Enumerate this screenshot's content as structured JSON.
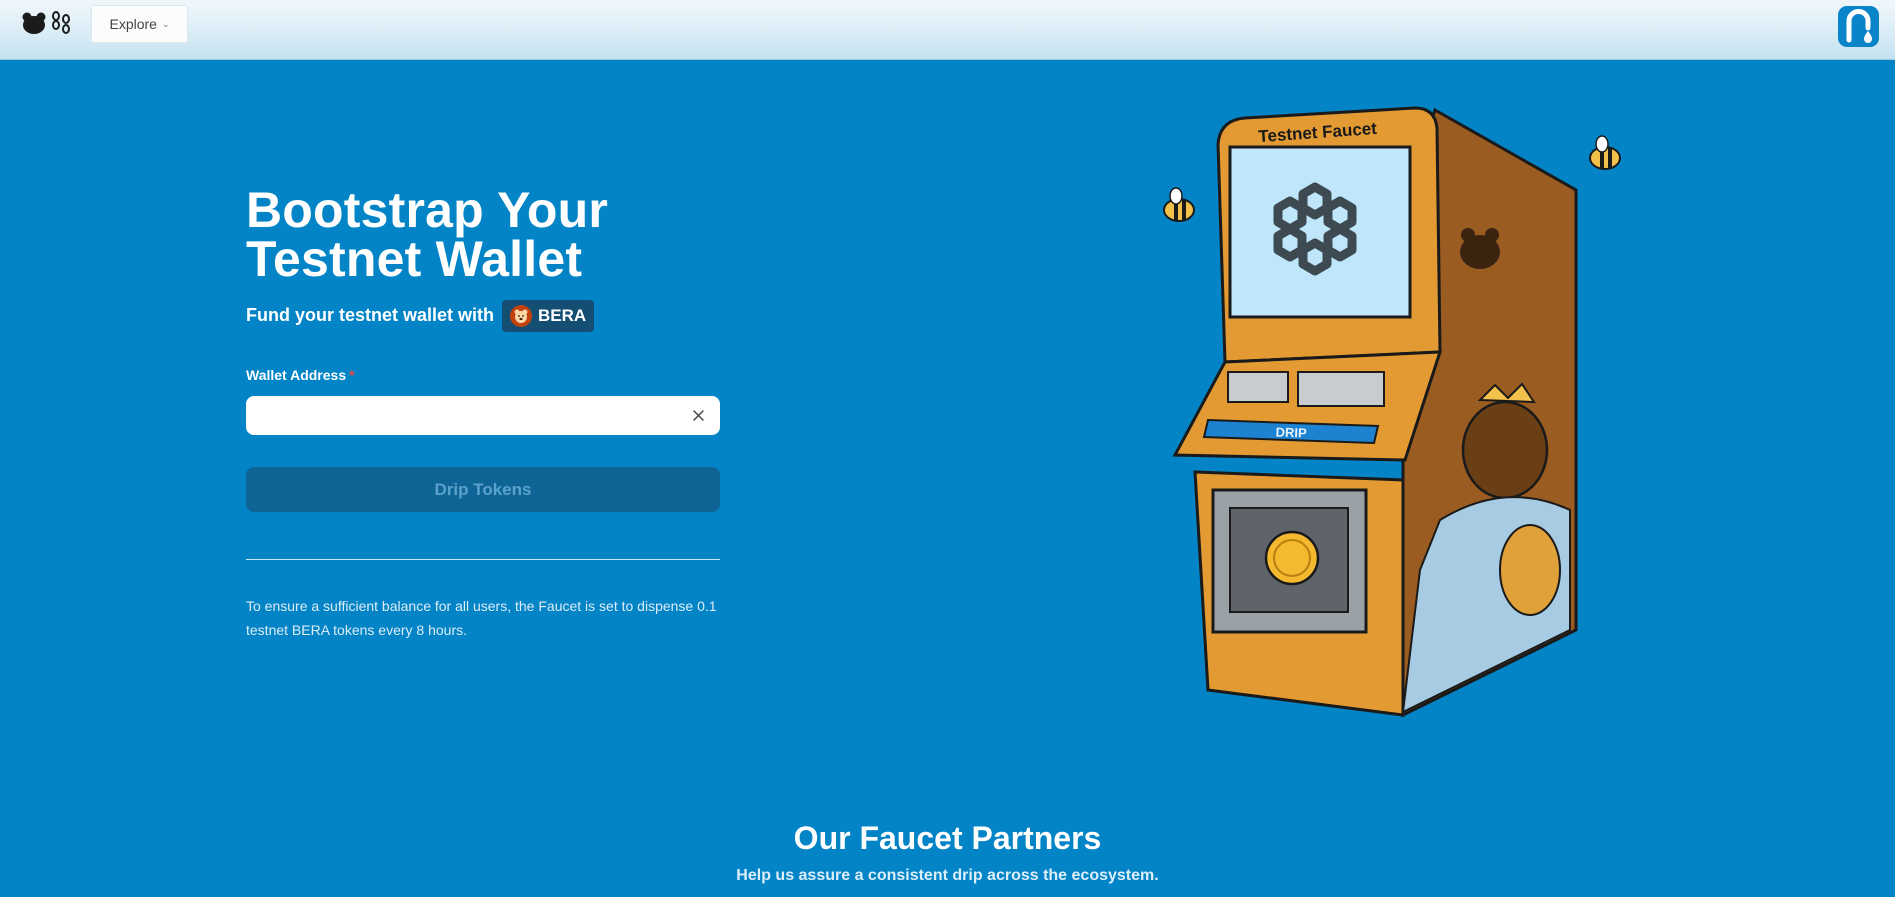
{
  "nav": {
    "explore_label": "Explore"
  },
  "hero": {
    "title_line1": "Bootstrap Your",
    "title_line2": "Testnet Wallet",
    "fund_text": "Fund your testnet wallet with",
    "token_label": "BERA"
  },
  "form": {
    "wallet_label": "Wallet Address",
    "required_mark": "*",
    "wallet_value": "",
    "wallet_placeholder": "",
    "submit_label": "Drip Tokens"
  },
  "notice": "To ensure a sufficient balance for all users, the Faucet is set to dispense 0.1 testnet BERA tokens every 8 hours.",
  "illustration": {
    "sign_text": "Testnet Faucet",
    "button_text": "DRIP"
  },
  "partners": {
    "title": "Our Faucet Partners",
    "subtitle": "Help us assure a consistent drip across the ecosystem."
  },
  "colors": {
    "background": "#0284c7",
    "button_disabled": "#0f6496",
    "required": "#ef4444",
    "machine_orange": "#e39a33",
    "machine_side": "#9a5c20"
  },
  "icons": {
    "logo": "bear-chain-logo",
    "explore_chevron": "chevron-down-icon",
    "faucet": "faucet-icon",
    "clear": "close-icon",
    "token": "bera-bear-icon"
  }
}
